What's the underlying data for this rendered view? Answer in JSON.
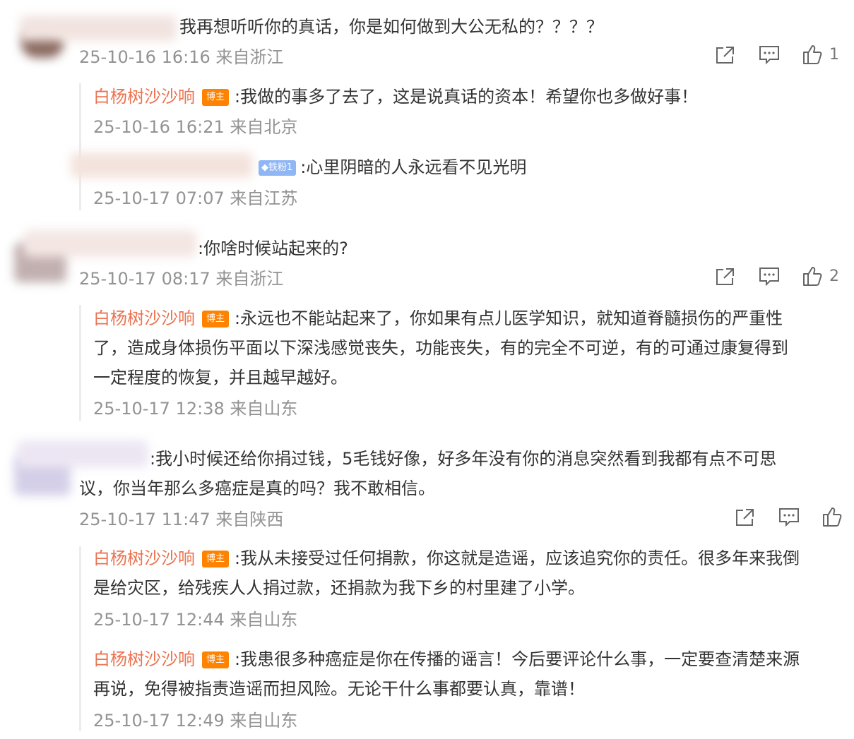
{
  "comments": [
    {
      "text": "我再想听听你的真话，你是如何做到大公无私的？？？？",
      "meta": "25-10-16 16:16 来自浙江",
      "likes": "1",
      "replies": [
        {
          "name": "白杨树沙沙响",
          "badge": "博主",
          "text": ":我做的事多了去了，这是说真话的资本！希望你也多做好事！",
          "meta": "25-10-16 16:21 来自北京"
        },
        {
          "badge": "铁粉1",
          "text": ":心里阴暗的人永远看不见光明",
          "meta": "25-10-17 07:07 来自江苏"
        }
      ]
    },
    {
      "text": ":你啥时候站起来的?",
      "meta": "25-10-17 08:17 来自浙江",
      "likes": "2",
      "replies": [
        {
          "name": "白杨树沙沙响",
          "badge": "博主",
          "line1": ":永远也不能站起来了，你如果有点儿医学知识，就知道脊髓损伤的严重性",
          "line2": "了，造成身体损伤平面以下深浅感觉丧失，功能丧失，有的完全不可逆，有的可通过康复得到",
          "line3": "一定程度的恢复，并且越早越好。",
          "meta": "25-10-17 12:38 来自山东"
        }
      ]
    },
    {
      "line1": ":我小时候还给你捐过钱，5毛钱好像，好多年没有你的消息突然看到我都有点不可思",
      "line2": "议，你当年那么多癌症是真的吗？我不敢相信。",
      "meta": "25-10-17 11:47 来自陕西",
      "replies": [
        {
          "name": "白杨树沙沙响",
          "badge": "博主",
          "line1": ":我从未接受过任何捐款，你这就是造谣，应该追究你的责任。很多年来我倒",
          "line2": "是给灾区，给残疾人人捐过款，还捐款为我下乡的村里建了小学。",
          "meta": "25-10-17 12:44 来自山东"
        },
        {
          "name": "白杨树沙沙响",
          "badge": "博主",
          "line1": ":我患很多种癌症是你在传播的谣言！今后要评论什么事，一定要查清楚来源",
          "line2": "再说，免得被指责造谣而担风险。无论干什么事都要认真，靠谱！",
          "meta": "25-10-17 12:49 来自山东"
        }
      ]
    }
  ],
  "colors": {
    "reply_name": "#eb7350",
    "host_badge": "#ff8200",
    "fan_badge": "#8fb6f5",
    "meta": "#939393"
  },
  "icons": [
    "share-icon",
    "comment-icon",
    "like-icon",
    "diamond-icon"
  ]
}
